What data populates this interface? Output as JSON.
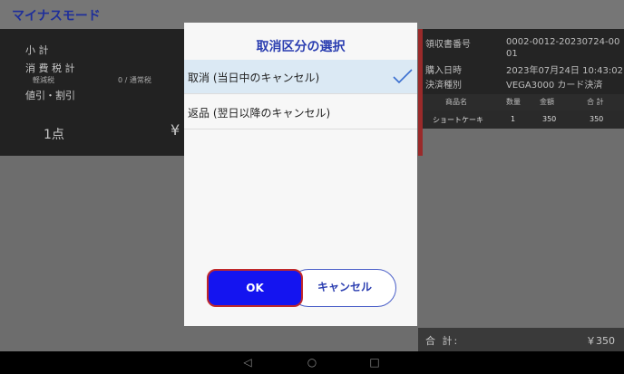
{
  "header": {
    "title": "マイナスモード"
  },
  "left": {
    "subtotal": "小 計",
    "tax": "消 費 税 計",
    "reduced": "軽減税",
    "normal": "0 / 通常税",
    "discount": "値引・割引",
    "count": "1点",
    "yen": "¥"
  },
  "right": {
    "receipt_label": "領収書番号",
    "receipt_value": "0002-0012-20230724-0001",
    "date_label": "購入日時",
    "date_value": "2023年07月24日 10:43:02",
    "payment_label": "決済種別",
    "payment_value": "VEGA3000 カード決済",
    "columns": [
      "商品名",
      "数量",
      "金額",
      "合 計"
    ],
    "rows": [
      {
        "name": "ショートケーキ",
        "qty": "1",
        "price": "350",
        "total": "350"
      }
    ],
    "total_label": "合 計:",
    "total_value": "￥350"
  },
  "dialog": {
    "title": "取消区分の選択",
    "options": [
      {
        "label": "取消 (当日中のキャンセル)",
        "selected": true
      },
      {
        "label": "返品 (翌日以降のキャンセル)",
        "selected": false
      }
    ],
    "ok_label": "OK",
    "cancel_label": "キャンセル"
  },
  "navbar": {
    "back": "◁",
    "home": "○",
    "recents": "□"
  },
  "colors": {
    "accent": "#2a3db0",
    "ok_button": "#1414f0",
    "ok_border": "#c0282a",
    "selected_row": "#dbe9f4"
  }
}
